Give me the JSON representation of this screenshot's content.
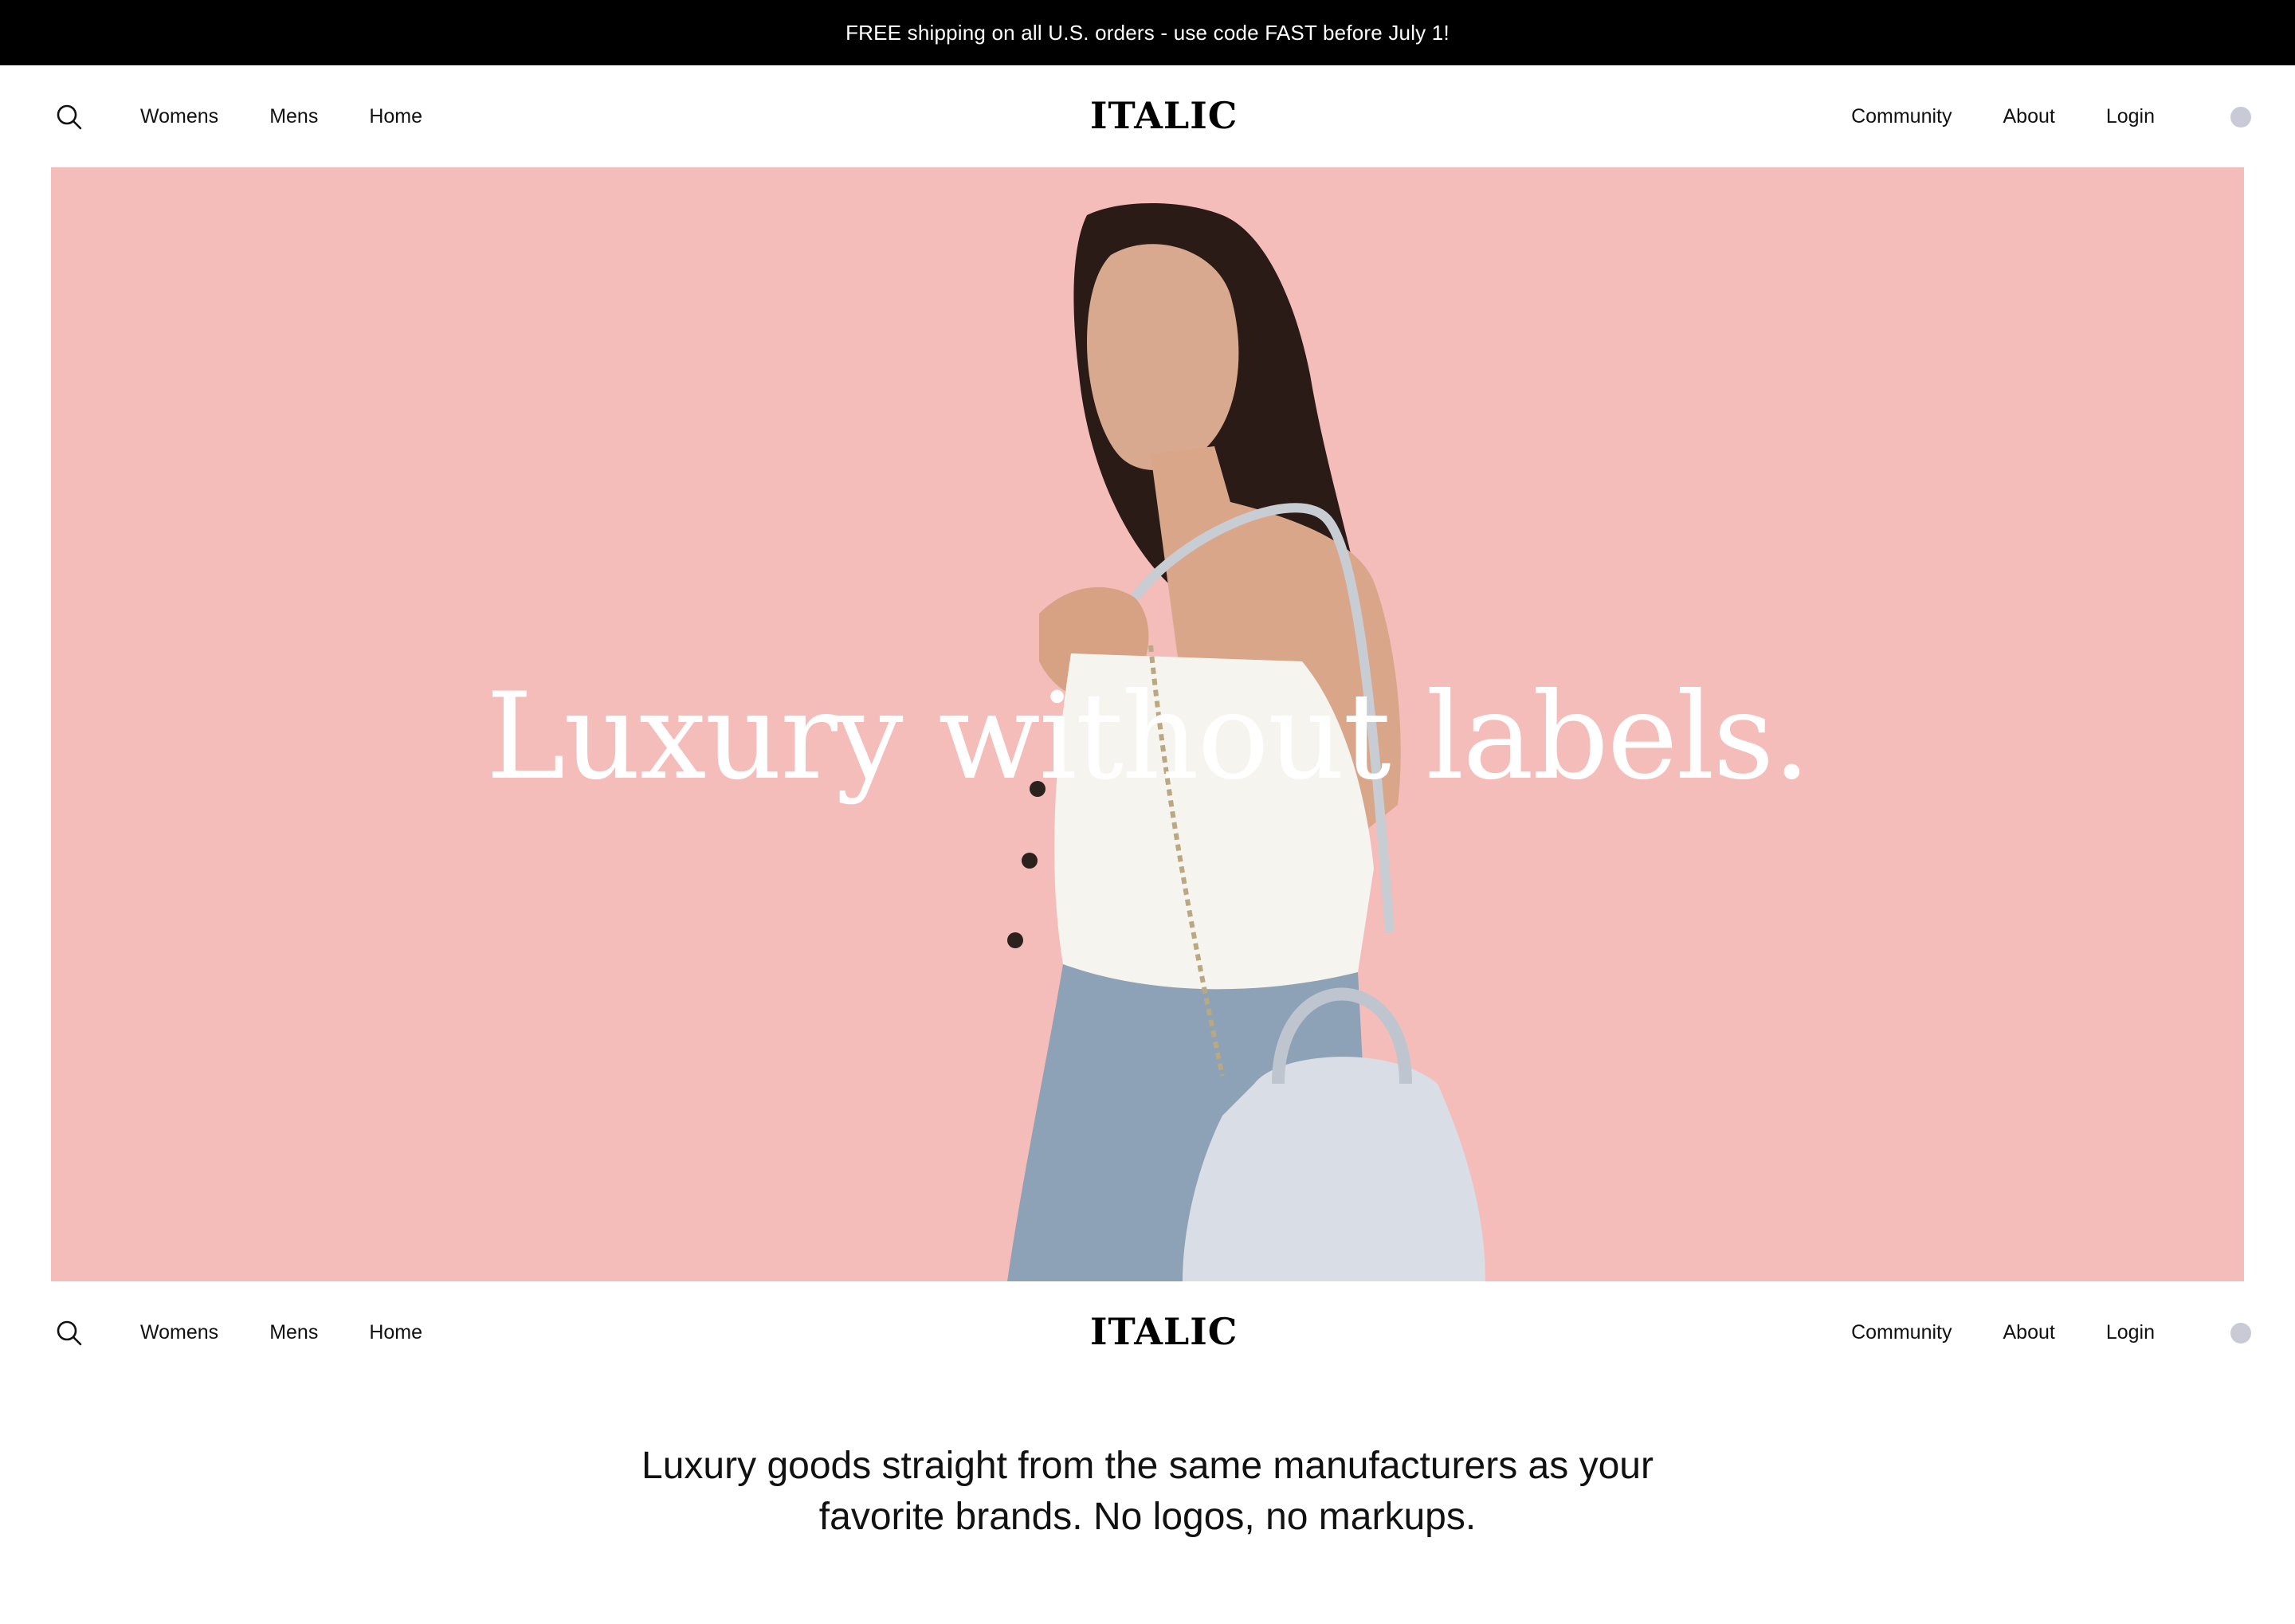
{
  "announcement": {
    "text": "FREE shipping on all U.S. orders - use code FAST before July 1!"
  },
  "nav": {
    "left_links": [
      "Womens",
      "Mens",
      "Home"
    ],
    "right_links": [
      "Community",
      "About",
      "Login"
    ],
    "logo_text": "ITALIC",
    "icons": {
      "search": "search-icon",
      "account": "account-dot-icon"
    }
  },
  "hero": {
    "headline": "Luxury without labels.",
    "background_color": "#f4bdba",
    "image_description_icon": "model-with-handbag-photo"
  },
  "tagline": {
    "line1": "Luxury goods straight from the same manufacturers as your",
    "line2": "favorite brands. No logos, no markups."
  },
  "colors": {
    "announcement_bg": "#000000",
    "hero_pink": "#f4bdba",
    "account_dot": "#c8cad6"
  }
}
